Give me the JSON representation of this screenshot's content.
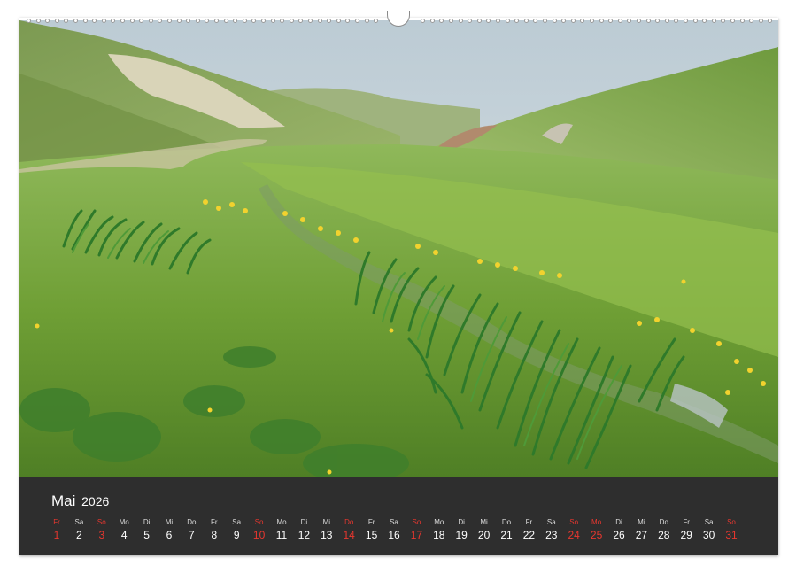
{
  "calendar": {
    "month": "Mai",
    "year": "2026",
    "days": [
      {
        "name": "Fr",
        "num": "1",
        "holiday": true
      },
      {
        "name": "Sa",
        "num": "2",
        "holiday": false
      },
      {
        "name": "So",
        "num": "3",
        "holiday": true
      },
      {
        "name": "Mo",
        "num": "4",
        "holiday": false
      },
      {
        "name": "Di",
        "num": "5",
        "holiday": false
      },
      {
        "name": "Mi",
        "num": "6",
        "holiday": false
      },
      {
        "name": "Do",
        "num": "7",
        "holiday": false
      },
      {
        "name": "Fr",
        "num": "8",
        "holiday": false
      },
      {
        "name": "Sa",
        "num": "9",
        "holiday": false
      },
      {
        "name": "So",
        "num": "10",
        "holiday": true
      },
      {
        "name": "Mo",
        "num": "11",
        "holiday": false
      },
      {
        "name": "Di",
        "num": "12",
        "holiday": false
      },
      {
        "name": "Mi",
        "num": "13",
        "holiday": false
      },
      {
        "name": "Do",
        "num": "14",
        "holiday": true
      },
      {
        "name": "Fr",
        "num": "15",
        "holiday": false
      },
      {
        "name": "Sa",
        "num": "16",
        "holiday": false
      },
      {
        "name": "So",
        "num": "17",
        "holiday": true
      },
      {
        "name": "Mo",
        "num": "18",
        "holiday": false
      },
      {
        "name": "Di",
        "num": "19",
        "holiday": false
      },
      {
        "name": "Mi",
        "num": "20",
        "holiday": false
      },
      {
        "name": "Do",
        "num": "21",
        "holiday": false
      },
      {
        "name": "Fr",
        "num": "22",
        "holiday": false
      },
      {
        "name": "Sa",
        "num": "23",
        "holiday": false
      },
      {
        "name": "So",
        "num": "24",
        "holiday": true
      },
      {
        "name": "Mo",
        "num": "25",
        "holiday": true
      },
      {
        "name": "Di",
        "num": "26",
        "holiday": false
      },
      {
        "name": "Mi",
        "num": "27",
        "holiday": false
      },
      {
        "name": "Do",
        "num": "28",
        "holiday": false
      },
      {
        "name": "Fr",
        "num": "29",
        "holiday": false
      },
      {
        "name": "Sa",
        "num": "30",
        "holiday": false
      },
      {
        "name": "So",
        "num": "31",
        "holiday": true
      }
    ]
  },
  "colors": {
    "calendar_background": "#2e2e2e",
    "holiday_red": "#e8372f",
    "sky": "#c9d6de",
    "grass": "#7fae3c"
  }
}
